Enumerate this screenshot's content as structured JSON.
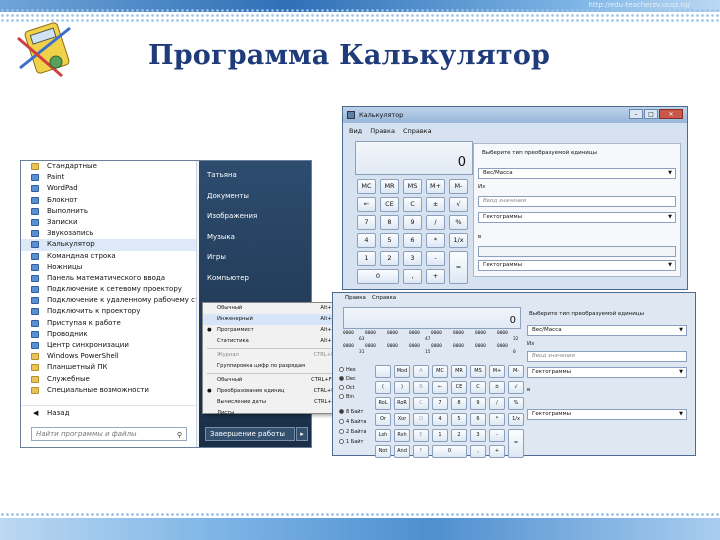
{
  "slide": {
    "title": "Программа Калькулятор",
    "url": "http://edu-teacherzv.ucoz.ru/"
  },
  "start_menu": {
    "programs": [
      {
        "label": "Стандартные",
        "kind": "folder"
      },
      {
        "label": "Paint",
        "kind": "prog"
      },
      {
        "label": "WordPad",
        "kind": "prog"
      },
      {
        "label": "Блокнот",
        "kind": "prog"
      },
      {
        "label": "Выполнить",
        "kind": "prog"
      },
      {
        "label": "Записки",
        "kind": "prog"
      },
      {
        "label": "Звукозапись",
        "kind": "prog"
      },
      {
        "label": "Калькулятор",
        "kind": "prog"
      },
      {
        "label": "Командная строка",
        "kind": "prog"
      },
      {
        "label": "Ножницы",
        "kind": "prog"
      },
      {
        "label": "Панель математического ввода",
        "kind": "prog"
      },
      {
        "label": "Подключение к сетевому проектору",
        "kind": "prog"
      },
      {
        "label": "Подключение к удаленному рабочему столу",
        "kind": "prog"
      },
      {
        "label": "Подключить к проектору",
        "kind": "prog"
      },
      {
        "label": "Приступая к работе",
        "kind": "prog"
      },
      {
        "label": "Проводник",
        "kind": "prog"
      },
      {
        "label": "Центр синхронизации",
        "kind": "prog"
      },
      {
        "label": "Windows PowerShell",
        "kind": "folder"
      },
      {
        "label": "Планшетный ПК",
        "kind": "folder"
      },
      {
        "label": "Служебные",
        "kind": "folder"
      },
      {
        "label": "Специальные возможности",
        "kind": "folder"
      }
    ],
    "back_label": "Назад",
    "search_placeholder": "Найти программы и файлы",
    "places": [
      "Татьяна",
      "Документы",
      "Изображения",
      "Музыка",
      "Игры",
      "Компьютер"
    ],
    "shutdown_label": "Завершение работы"
  },
  "view_menu": {
    "items": [
      {
        "label": "Обычный",
        "shortcut": "Alt+1"
      },
      {
        "label": "Инженерный",
        "shortcut": "Alt+2"
      },
      {
        "label": "Программист",
        "shortcut": "Alt+3"
      },
      {
        "label": "Статистика",
        "shortcut": "Alt+4"
      },
      {
        "label": "Журнал",
        "shortcut": "CTRL+H"
      },
      {
        "label": "Группировка цифр по разрядам",
        "shortcut": ""
      },
      {
        "label": "Обычный",
        "shortcut": "CTRL+F4"
      },
      {
        "label": "Преобразование единиц",
        "shortcut": "CTRL+U"
      },
      {
        "label": "Вычисление даты",
        "shortcut": "CTRL+E"
      },
      {
        "label": "Листы",
        "shortcut": ""
      }
    ]
  },
  "calc_standard": {
    "title": "Калькулятор",
    "menu": [
      "Вид",
      "Правка",
      "Справка"
    ],
    "display": "0",
    "memory_keys": [
      "MC",
      "MR",
      "MS",
      "M+",
      "M-"
    ],
    "keys": [
      "←",
      "CE",
      "C",
      "±",
      "√",
      "7",
      "8",
      "9",
      "/",
      "%",
      "4",
      "5",
      "6",
      "*",
      "1/x",
      "1",
      "2",
      "3",
      "-",
      "=",
      "0",
      ",",
      "+"
    ],
    "conv_title": "Выберите тип преобразуемой единицы",
    "conv_type": "Вес/Масса",
    "from_label": "Из",
    "input_placeholder": "Ввод значения",
    "from_unit": "Гектограммы",
    "to_label": "в",
    "to_unit": "Гектограммы"
  },
  "calc_engineering": {
    "menu": [
      "Правка",
      "Справка"
    ],
    "display": "0",
    "bits_row1": [
      "0000",
      "0000",
      "0000",
      "0000",
      "0000",
      "0000",
      "0000",
      "0000"
    ],
    "bits_row1_marks": [
      "63",
      "",
      "",
      "47",
      "",
      "",
      "",
      "32"
    ],
    "bits_row2": [
      "0000",
      "0000",
      "0000",
      "0000",
      "0000",
      "0000",
      "0000",
      "0000"
    ],
    "bits_row2_marks": [
      "31",
      "",
      "",
      "15",
      "",
      "",
      "",
      "0"
    ],
    "radios": [
      "Hex",
      "Dec",
      "Oct",
      "Bin"
    ],
    "word_radios": [
      "8 Байт",
      "4 Байта",
      "2 Байта",
      "1 Байт"
    ],
    "keys_row1": [
      "",
      "Mod",
      "A",
      "MC",
      "MR",
      "MS",
      "M+",
      "M-"
    ],
    "keys_row2": [
      "(",
      ")",
      "B",
      "←",
      "CE",
      "C",
      "±",
      "√"
    ],
    "keys_row3": [
      "RoL",
      "RoR",
      "C",
      "7",
      "8",
      "9",
      "/",
      "%"
    ],
    "keys_row4": [
      "Or",
      "Xor",
      "D",
      "4",
      "5",
      "6",
      "*",
      "1/x"
    ],
    "keys_row5": [
      "Lsh",
      "Rsh",
      "E",
      "1",
      "2",
      "3",
      "-",
      "="
    ],
    "keys_row6": [
      "Not",
      "And",
      "F",
      "0",
      ",",
      "+"
    ],
    "conv_title": "Выберите тип преобразуемой единицы",
    "conv_type": "Вес/Масса",
    "from_label": "Из",
    "input_placeholder": "Ввод значения",
    "from_unit": "Гектограммы",
    "to_label": "в",
    "to_unit": "Гектограммы"
  }
}
